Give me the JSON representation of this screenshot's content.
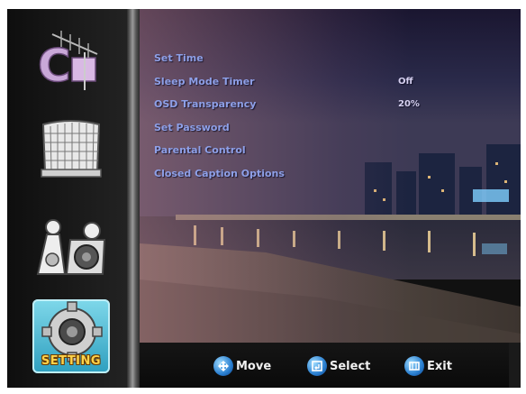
{
  "sidebar": {
    "items": [
      {
        "name": "antenna-channel-menu",
        "icon": "antenna-icon"
      },
      {
        "name": "picture-menu",
        "icon": "screen-grid-icon"
      },
      {
        "name": "audio-menu",
        "icon": "speakers-icon"
      },
      {
        "name": "setting-menu",
        "icon": "gear-icon",
        "label": "SETTING",
        "selected": true
      }
    ]
  },
  "menu": {
    "items": [
      {
        "label": "Set Time",
        "value": ""
      },
      {
        "label": "Sleep Mode Timer",
        "value": "Off"
      },
      {
        "label": "OSD Transparency",
        "value": "20%"
      },
      {
        "label": "Set Password",
        "value": ""
      },
      {
        "label": "Parental Control",
        "value": ""
      },
      {
        "label": "Closed Caption Options",
        "value": ""
      }
    ]
  },
  "footer": {
    "move": "Move",
    "select": "Select",
    "exit": "Exit"
  },
  "colors": {
    "menu_text": "#8ea0e8",
    "value_text": "#d6d0f0",
    "selected_tile": "#4fc0dc",
    "setting_label": "#ffd34a"
  }
}
